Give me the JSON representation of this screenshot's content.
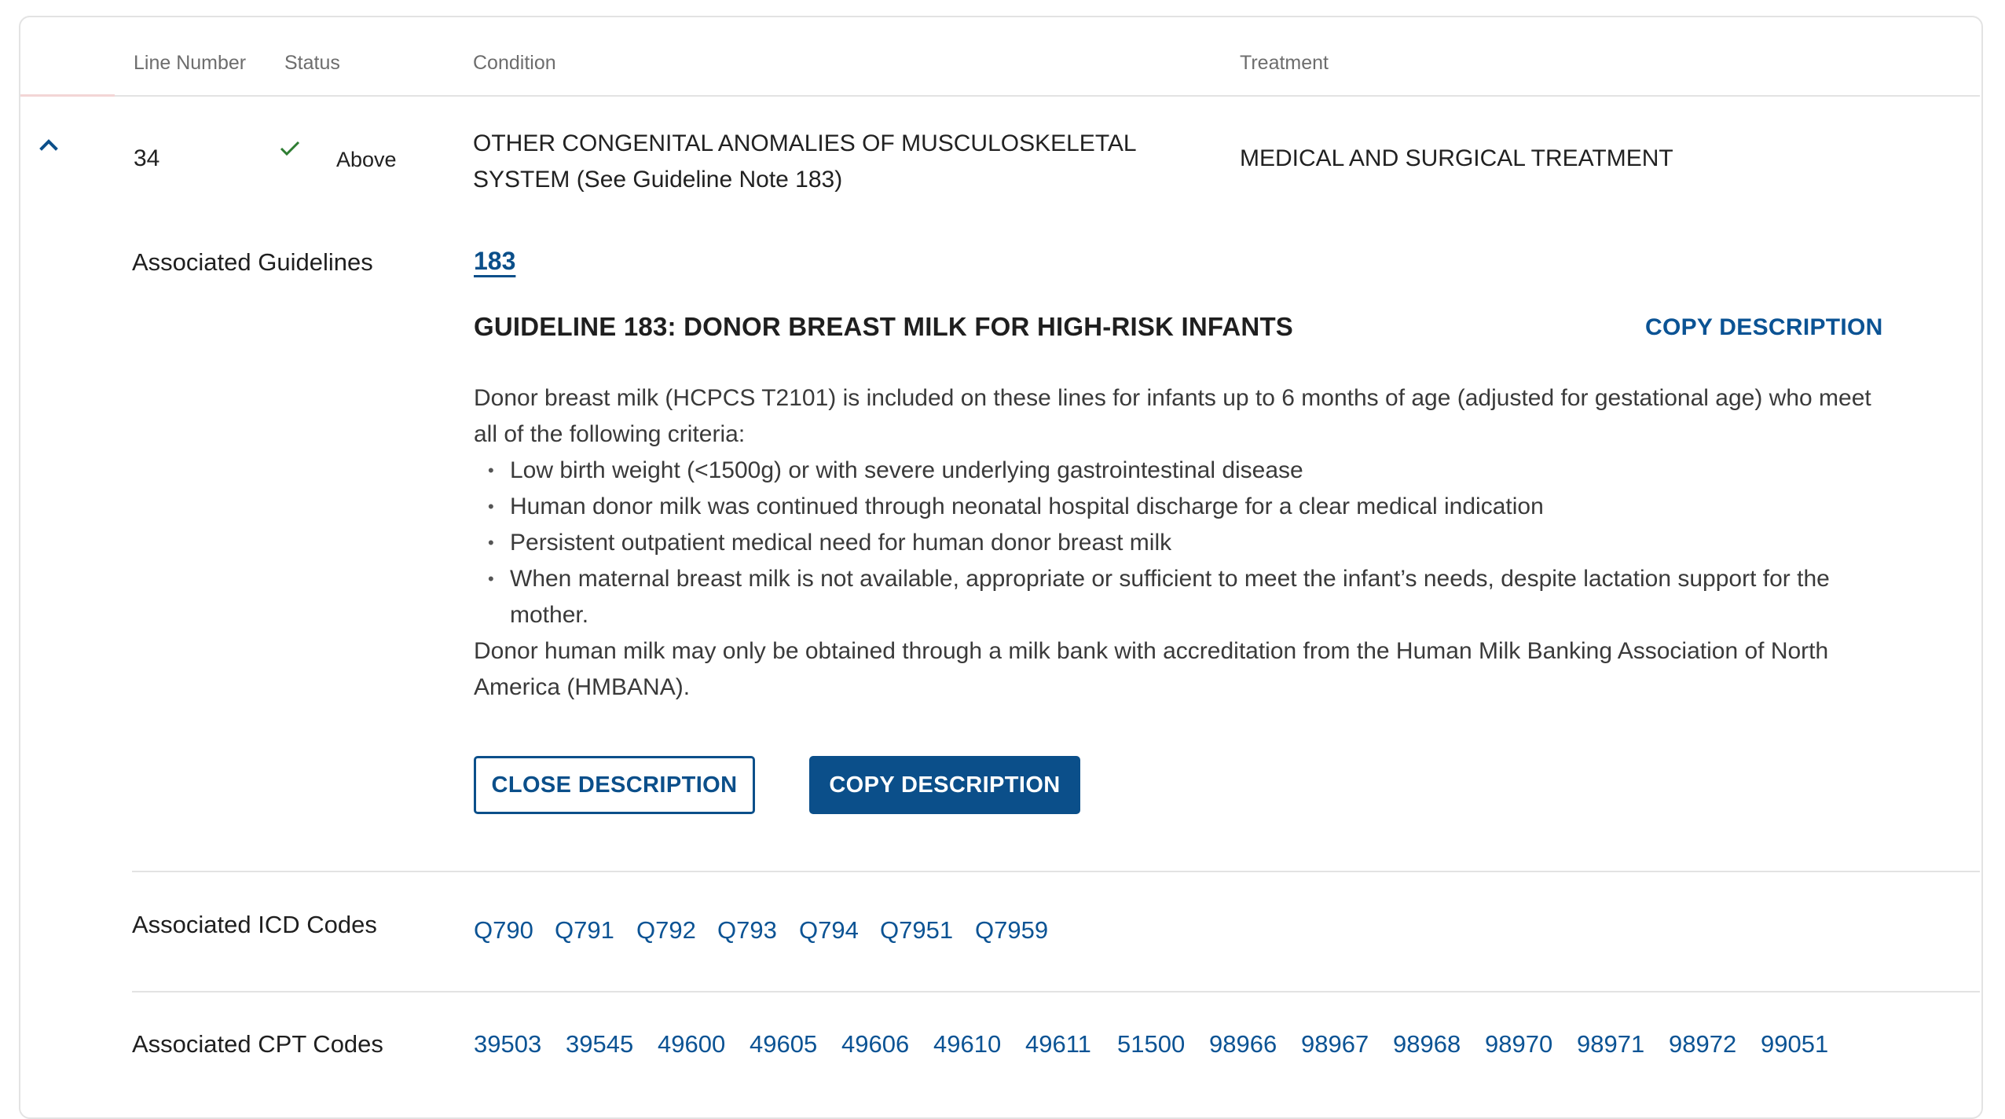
{
  "table_header": {
    "line_number": "Line Number",
    "status": "Status",
    "condition": "Condition",
    "treatment": "Treatment"
  },
  "row": {
    "line_number": "34",
    "status": "Above",
    "condition_line1": "OTHER CONGENITAL ANOMALIES OF MUSCULOSKELETAL",
    "condition_line2": "SYSTEM (See Guideline Note 183)",
    "treatment": "MEDICAL AND SURGICAL TREATMENT"
  },
  "guidelines": {
    "label": "Associated Guidelines",
    "number": "183",
    "title": "GUIDELINE 183: DONOR BREAST MILK FOR HIGH-RISK INFANTS",
    "copy_link": "COPY DESCRIPTION",
    "intro": "Donor breast milk (HCPCS T2101) is included on these lines for infants up to 6 months of age (adjusted for gestational age) who meet all of the following criteria:",
    "criteria": [
      "Low birth weight (<1500g) or with severe underlying gastrointestinal disease",
      "Human donor milk was continued through neonatal hospital discharge for a clear medical indication",
      "Persistent outpatient medical need for human donor breast milk",
      "When maternal breast milk is not available, appropriate or sufficient to meet the infant’s needs, despite lactation support for the mother."
    ],
    "outro": "Donor human milk may only be obtained through a milk bank with accreditation from the Human Milk Banking Association of North America (HMBANA).",
    "close_button": "CLOSE DESCRIPTION",
    "copy_button": "COPY DESCRIPTION"
  },
  "icd": {
    "label": "Associated ICD Codes",
    "codes": [
      "Q790",
      "Q791",
      "Q792",
      "Q793",
      "Q794",
      "Q7951",
      "Q7959"
    ]
  },
  "cpt": {
    "label": "Associated CPT Codes",
    "codes": [
      "39503",
      "39545",
      "49600",
      "49605",
      "49606",
      "49610",
      "49611",
      "51500",
      "98966",
      "98967",
      "98968",
      "98970",
      "98971",
      "98972",
      "99051"
    ]
  },
  "colors": {
    "accent": "#0b4f8a",
    "link": "#0b5394",
    "check": "#2e7d32",
    "divider": "#e3e3e3"
  },
  "icons": {
    "expand": "chevron-up-icon",
    "status": "checkmark-icon"
  }
}
